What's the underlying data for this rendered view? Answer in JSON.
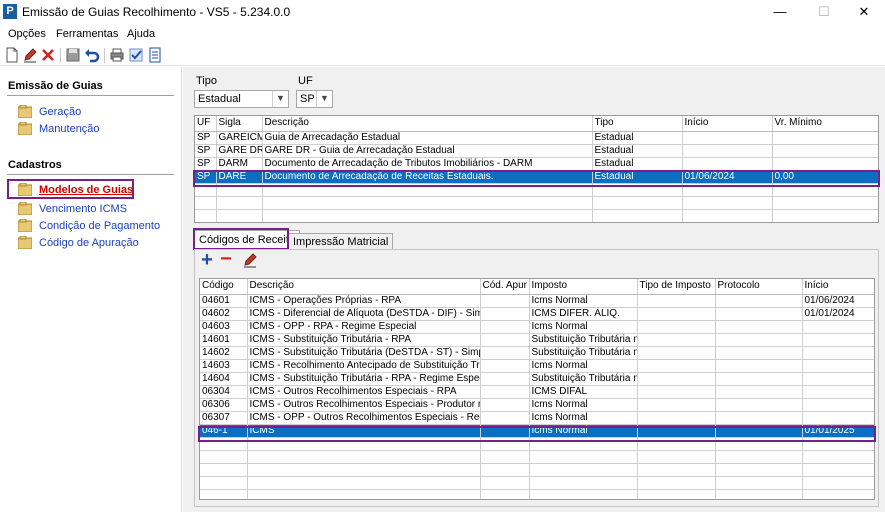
{
  "window": {
    "title": "Emissão de Guias Recolhimento - VS5 - 5.234.0.0",
    "app_icon": "P",
    "minimize": "—",
    "maximize": "☐",
    "close": "✕"
  },
  "menu": {
    "items": [
      {
        "label": "Opções"
      },
      {
        "label": "Ferramentas"
      },
      {
        "label": "Ajuda"
      }
    ]
  },
  "toolbar": {
    "icons": [
      "new-document-icon",
      "edit-pencil-icon",
      "delete-x-icon",
      "save-disk-icon",
      "undo-icon",
      "print-icon",
      "check-icon",
      "report-icon"
    ]
  },
  "sidebar": {
    "emissao": {
      "title": "Emissão de Guias",
      "items": [
        {
          "label": "Geração"
        },
        {
          "label": "Manutenção"
        }
      ]
    },
    "cadastros": {
      "title": "Cadastros",
      "items": [
        {
          "label": "Modelos de Guias",
          "active": true
        },
        {
          "label": "Vencimento ICMS"
        },
        {
          "label": "Condição de Pagamento"
        },
        {
          "label": "Código de Apuração"
        }
      ]
    }
  },
  "filters": {
    "tipo_label": "Tipo",
    "tipo_value": "Estadual",
    "uf_label": "UF",
    "uf_value": "SP",
    "arrow": "▼"
  },
  "guias_table": {
    "columns": [
      "UF",
      "Sigla",
      "Descrição",
      "Tipo",
      "Início",
      "Vr. Mínimo"
    ],
    "rows": [
      [
        "SP",
        "GAREICMS",
        "Guia de Arrecadação Estadual",
        "Estadual",
        "",
        ""
      ],
      [
        "SP",
        "GARE DR",
        "GARE DR - Guia de Arrecadação Estadual",
        "Estadual",
        "",
        ""
      ],
      [
        "SP",
        "DARM",
        "Documento de Arrecadação de Tributos Imobiliários - DARM",
        "Estadual",
        "",
        ""
      ],
      [
        "SP",
        "DARE",
        "Documento de Arrecadação de Receitas Estaduais.",
        "Estadual",
        "01/06/2024",
        "0,00"
      ],
      [
        "",
        "",
        "",
        "",
        "",
        ""
      ],
      [
        "",
        "",
        "",
        "",
        "",
        ""
      ],
      [
        "",
        "",
        "",
        "",
        "",
        ""
      ]
    ],
    "selected_row": 3
  },
  "tabs": [
    {
      "label": "Códigos de Receita",
      "active": true
    },
    {
      "label": "Impressão Matricial",
      "active": false
    }
  ],
  "receita_toolbar": {
    "add": "+",
    "remove": "−"
  },
  "receita_table": {
    "columns": [
      "Código",
      "Descrição",
      "Cód. Apur",
      "Imposto",
      "Tipo de Imposto",
      "Protocolo",
      "Início"
    ],
    "rows": [
      [
        "04601",
        "ICMS - Operações Próprias - RPA",
        "",
        "Icms Normal",
        "",
        "",
        "01/06/2024"
      ],
      [
        "04602",
        "ICMS - Diferencial de Alíquota (DeSTDA - DIF) - Simples",
        "",
        "ICMS DIFER. ALIQ.",
        "",
        "",
        "01/01/2024"
      ],
      [
        "04603",
        "ICMS - OPP - RPA - Regime Especial",
        "",
        "Icms Normal",
        "",
        "",
        ""
      ],
      [
        "14601",
        "ICMS - Substituição Tributária - RPA",
        "",
        "Substituição Tributária no",
        "",
        "",
        ""
      ],
      [
        "14602",
        "ICMS - Substituição Tributária (DeSTDA - ST) - Simples",
        "",
        "Substituição Tributária no",
        "",
        "",
        ""
      ],
      [
        "14603",
        "ICMS - Recolhimento Antecipado de Substituição Tribut",
        "",
        "Icms Normal",
        "",
        "",
        ""
      ],
      [
        "14604",
        "ICMS - Substituição Tributária - RPA - Regime Especial",
        "",
        "Substituição Tributária no",
        "",
        "",
        ""
      ],
      [
        "06304",
        "ICMS - Outros Recolhimentos Especiais - RPA",
        "",
        "ICMS DIFAL",
        "",
        "",
        ""
      ],
      [
        "06306",
        "ICMS - Outros Recolhimentos Especiais - Produtor rural",
        "",
        "Icms Normal",
        "",
        "",
        ""
      ],
      [
        "06307",
        "ICMS - OPP - Outros Recolhimentos Especiais - Regime",
        "",
        "Icms Normal",
        "",
        "",
        ""
      ],
      [
        "046-1",
        "ICMS",
        "",
        "Icms Normal",
        "",
        "",
        "01/01/2025"
      ],
      [
        "",
        "",
        "",
        "",
        "",
        "",
        ""
      ],
      [
        "",
        "",
        "",
        "",
        "",
        "",
        ""
      ],
      [
        "",
        "",
        "",
        "",
        "",
        "",
        ""
      ],
      [
        "",
        "",
        "",
        "",
        "",
        "",
        ""
      ],
      [
        "",
        "",
        "",
        "",
        "",
        "",
        ""
      ]
    ],
    "selected_row": 10
  },
  "colors": {
    "selection": "#0a6fc2",
    "highlight_box": "#7a1e8a",
    "link": "#1c3fbd",
    "active_link": "#d40000"
  }
}
